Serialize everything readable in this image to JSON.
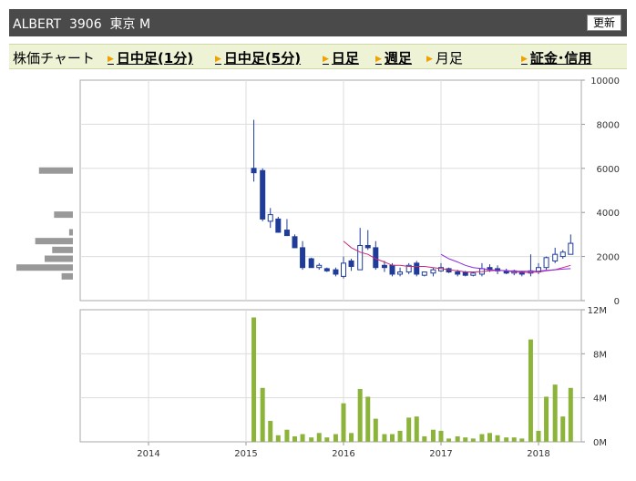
{
  "header": {
    "title": "ALBERT  3906  東京 M",
    "refresh_label": "更新"
  },
  "nav": {
    "items": [
      {
        "label": "株価チャート",
        "link": false
      },
      {
        "label": "日中足(1分)",
        "link": true
      },
      {
        "label": "日中足(5分)",
        "link": true
      },
      {
        "label": "日足",
        "link": true
      },
      {
        "label": "週足",
        "link": true
      },
      {
        "label": "月足",
        "link": false
      },
      {
        "label": "証金･信用",
        "link": true
      }
    ]
  },
  "colors": {
    "up_body": "#ffffff",
    "down_body": "#1f3c99",
    "candle_outline": "#1f3c99",
    "ma_short": "#c8287a",
    "ma_long": "#8a2be2",
    "volume_bar": "#8cb33a",
    "profile_bar": "#999999",
    "grid": "#dddddd",
    "frame": "#aaaaaa"
  },
  "chart_data": [
    {
      "type": "candlestick",
      "title": "",
      "x_tick_labels": [
        "2014",
        "2015",
        "2016",
        "2017",
        "2018"
      ],
      "x_range": [
        2013.3,
        2018.35
      ],
      "y_tick_labels": [
        "10000",
        "8000",
        "6000",
        "4000",
        "2000",
        "0"
      ],
      "ylim": [
        0,
        10000
      ],
      "grid": true,
      "candles": [
        {
          "t": 2015.08,
          "o": 6000,
          "h": 8200,
          "l": 5400,
          "c": 5800
        },
        {
          "t": 2015.17,
          "o": 5900,
          "h": 6000,
          "l": 3600,
          "c": 3700
        },
        {
          "t": 2015.25,
          "o": 3600,
          "h": 4200,
          "l": 3300,
          "c": 3900
        },
        {
          "t": 2015.33,
          "o": 3700,
          "h": 3800,
          "l": 3100,
          "c": 3100
        },
        {
          "t": 2015.42,
          "o": 3200,
          "h": 3700,
          "l": 3000,
          "c": 2950
        },
        {
          "t": 2015.5,
          "o": 2900,
          "h": 3000,
          "l": 2400,
          "c": 2400
        },
        {
          "t": 2015.58,
          "o": 2400,
          "h": 2700,
          "l": 1400,
          "c": 1500
        },
        {
          "t": 2015.67,
          "o": 1900,
          "h": 1950,
          "l": 1500,
          "c": 1500
        },
        {
          "t": 2015.75,
          "o": 1500,
          "h": 1700,
          "l": 1400,
          "c": 1600
        },
        {
          "t": 2015.83,
          "o": 1450,
          "h": 1500,
          "l": 1300,
          "c": 1350
        },
        {
          "t": 2015.92,
          "o": 1400,
          "h": 1500,
          "l": 1100,
          "c": 1200
        },
        {
          "t": 2016.0,
          "o": 1100,
          "h": 2000,
          "l": 1000,
          "c": 1700
        },
        {
          "t": 2016.08,
          "o": 1800,
          "h": 1900,
          "l": 1350,
          "c": 1550
        },
        {
          "t": 2016.17,
          "o": 1400,
          "h": 3300,
          "l": 1400,
          "c": 2500
        },
        {
          "t": 2016.25,
          "o": 2500,
          "h": 3200,
          "l": 2300,
          "c": 2400
        },
        {
          "t": 2016.33,
          "o": 2400,
          "h": 2700,
          "l": 1400,
          "c": 1500
        },
        {
          "t": 2016.42,
          "o": 1600,
          "h": 1800,
          "l": 1300,
          "c": 1500
        },
        {
          "t": 2016.5,
          "o": 1600,
          "h": 1700,
          "l": 1100,
          "c": 1200
        },
        {
          "t": 2016.58,
          "o": 1200,
          "h": 1500,
          "l": 1100,
          "c": 1300
        },
        {
          "t": 2016.67,
          "o": 1300,
          "h": 1700,
          "l": 1200,
          "c": 1600
        },
        {
          "t": 2016.75,
          "o": 1700,
          "h": 1800,
          "l": 1100,
          "c": 1200
        },
        {
          "t": 2016.83,
          "o": 1150,
          "h": 1300,
          "l": 1100,
          "c": 1300
        },
        {
          "t": 2016.92,
          "o": 1250,
          "h": 1500,
          "l": 1100,
          "c": 1400
        },
        {
          "t": 2017.0,
          "o": 1350,
          "h": 1700,
          "l": 1300,
          "c": 1500
        },
        {
          "t": 2017.08,
          "o": 1450,
          "h": 1500,
          "l": 1250,
          "c": 1300
        },
        {
          "t": 2017.17,
          "o": 1300,
          "h": 1400,
          "l": 1100,
          "c": 1200
        },
        {
          "t": 2017.25,
          "o": 1300,
          "h": 1350,
          "l": 1100,
          "c": 1150
        },
        {
          "t": 2017.33,
          "o": 1150,
          "h": 1300,
          "l": 1100,
          "c": 1250
        },
        {
          "t": 2017.42,
          "o": 1200,
          "h": 1700,
          "l": 1100,
          "c": 1450
        },
        {
          "t": 2017.5,
          "o": 1500,
          "h": 1650,
          "l": 1300,
          "c": 1400
        },
        {
          "t": 2017.58,
          "o": 1450,
          "h": 1600,
          "l": 1200,
          "c": 1350
        },
        {
          "t": 2017.67,
          "o": 1350,
          "h": 1450,
          "l": 1200,
          "c": 1250
        },
        {
          "t": 2017.75,
          "o": 1250,
          "h": 1400,
          "l": 1150,
          "c": 1350
        },
        {
          "t": 2017.83,
          "o": 1300,
          "h": 1350,
          "l": 1100,
          "c": 1200
        },
        {
          "t": 2017.92,
          "o": 1250,
          "h": 2100,
          "l": 1100,
          "c": 1350
        },
        {
          "t": 2018.0,
          "o": 1300,
          "h": 1700,
          "l": 1200,
          "c": 1500
        },
        {
          "t": 2018.08,
          "o": 1500,
          "h": 2000,
          "l": 1400,
          "c": 1950
        },
        {
          "t": 2018.17,
          "o": 1800,
          "h": 2400,
          "l": 1700,
          "c": 2100
        },
        {
          "t": 2018.25,
          "o": 2000,
          "h": 2300,
          "l": 1900,
          "c": 2200
        },
        {
          "t": 2018.33,
          "o": 2100,
          "h": 3000,
          "l": 2100,
          "c": 2600
        }
      ],
      "ma_short": [
        [
          2016.0,
          2700
        ],
        [
          2016.08,
          2400
        ],
        [
          2016.17,
          2200
        ],
        [
          2016.25,
          2100
        ],
        [
          2016.33,
          1900
        ],
        [
          2016.42,
          1750
        ],
        [
          2016.5,
          1600
        ],
        [
          2016.58,
          1600
        ],
        [
          2016.67,
          1550
        ],
        [
          2016.75,
          1550
        ],
        [
          2016.83,
          1550
        ],
        [
          2016.92,
          1500
        ],
        [
          2017.0,
          1450
        ],
        [
          2017.08,
          1400
        ],
        [
          2017.17,
          1350
        ],
        [
          2017.25,
          1300
        ],
        [
          2017.33,
          1300
        ],
        [
          2017.42,
          1320
        ],
        [
          2017.5,
          1350
        ],
        [
          2017.58,
          1370
        ],
        [
          2017.67,
          1350
        ],
        [
          2017.75,
          1300
        ],
        [
          2017.83,
          1280
        ],
        [
          2017.92,
          1280
        ],
        [
          2018.0,
          1300
        ],
        [
          2018.08,
          1350
        ],
        [
          2018.17,
          1400
        ],
        [
          2018.25,
          1500
        ],
        [
          2018.33,
          1600
        ]
      ],
      "ma_long": [
        [
          2017.0,
          2100
        ],
        [
          2017.08,
          1900
        ],
        [
          2017.17,
          1750
        ],
        [
          2017.25,
          1600
        ],
        [
          2017.33,
          1500
        ],
        [
          2017.42,
          1450
        ],
        [
          2017.5,
          1400
        ],
        [
          2017.58,
          1380
        ],
        [
          2017.67,
          1360
        ],
        [
          2017.75,
          1340
        ],
        [
          2017.83,
          1330
        ],
        [
          2017.92,
          1330
        ],
        [
          2018.0,
          1340
        ],
        [
          2018.08,
          1370
        ],
        [
          2018.17,
          1400
        ],
        [
          2018.25,
          1430
        ],
        [
          2018.33,
          1450
        ]
      ],
      "volume_profile": [
        {
          "price": 5900,
          "volume": 0.9
        },
        {
          "price": 3900,
          "volume": 0.5
        },
        {
          "price": 3100,
          "volume": 0.1
        },
        {
          "price": 2700,
          "volume": 1.0
        },
        {
          "price": 2300,
          "volume": 0.55
        },
        {
          "price": 1900,
          "volume": 0.75
        },
        {
          "price": 1500,
          "volume": 1.5
        },
        {
          "price": 1100,
          "volume": 0.3
        }
      ]
    },
    {
      "type": "bar",
      "title": "",
      "y_tick_labels": [
        "12M",
        "8M",
        "4M",
        "0M"
      ],
      "ylim": [
        0,
        12
      ],
      "grid": true,
      "x": [
        2015.08,
        2015.17,
        2015.25,
        2015.33,
        2015.42,
        2015.5,
        2015.58,
        2015.67,
        2015.75,
        2015.83,
        2015.92,
        2016.0,
        2016.08,
        2016.17,
        2016.25,
        2016.33,
        2016.42,
        2016.5,
        2016.58,
        2016.67,
        2016.75,
        2016.83,
        2016.92,
        2017.0,
        2017.08,
        2017.17,
        2017.25,
        2017.33,
        2017.42,
        2017.5,
        2017.58,
        2017.67,
        2017.75,
        2017.83,
        2017.92,
        2018.0,
        2018.08,
        2018.17,
        2018.25,
        2018.33
      ],
      "values": [
        11.3,
        4.9,
        1.9,
        0.6,
        1.1,
        0.5,
        0.7,
        0.4,
        0.8,
        0.4,
        0.7,
        3.5,
        0.8,
        4.8,
        4.1,
        2.1,
        0.7,
        0.7,
        1.0,
        2.2,
        2.3,
        0.5,
        1.1,
        1.0,
        0.3,
        0.5,
        0.4,
        0.3,
        0.7,
        0.8,
        0.6,
        0.4,
        0.4,
        0.3,
        9.3,
        1.0,
        4.1,
        5.2,
        2.3,
        4.9
      ]
    }
  ]
}
